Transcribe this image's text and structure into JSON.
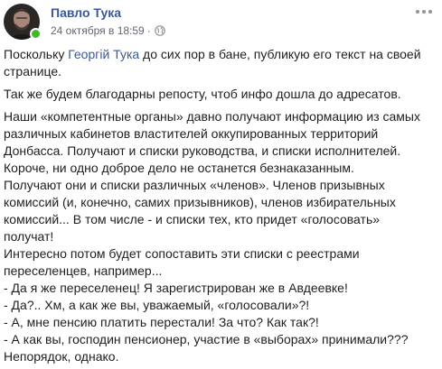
{
  "post": {
    "author": "Павло Тука",
    "timestamp": "24 октября в 18:59",
    "separator": "·",
    "privacy_icon": "globe-icon",
    "more_icon": "more-horizontal-icon",
    "online_color": "#42b72a",
    "link_color": "#385898"
  },
  "body": {
    "para1": {
      "prefix": "Поскольку ",
      "mention": "Георгій Тука",
      "suffix_line1": " до сих пор в бане, публикую его текст на своей",
      "line2": "странице."
    },
    "para2": "Так же будем благодарны репосту, чтоб инфо дошла до адресатов.",
    "para3_lines": [
      "Наши «компетентные органы» давно получают информацию из самых",
      "различных кабинетов властителей оккупированных территорий",
      "Донбасса. Получают и списки руководства, и списки исполнителей.",
      "Короче, ни одно доброе дело не останется безнаказанным.",
      "Получают они и списки различных «членов». Членов призывных",
      "комиссий (и, конечно, самих призывников), членов избирательных",
      "комиссий... В том числе - и списки тех, кто придет «голосовать»",
      "получат!",
      "Интересно потом будет сопоставить эти списки с реестрами",
      "переселенцев, например...",
      "- Да я же переселенец! Я зарегистрирован же в Авдеевке!",
      "- Да?.. Хм, а как же вы, уважаемый, «голосовали»?!",
      "- А, мне пенсию платить перестали! За что? Как так?!",
      "- А как вы, господин пенсионер, участие в «выборах» принимали???",
      "Непорядок, однако."
    ]
  }
}
